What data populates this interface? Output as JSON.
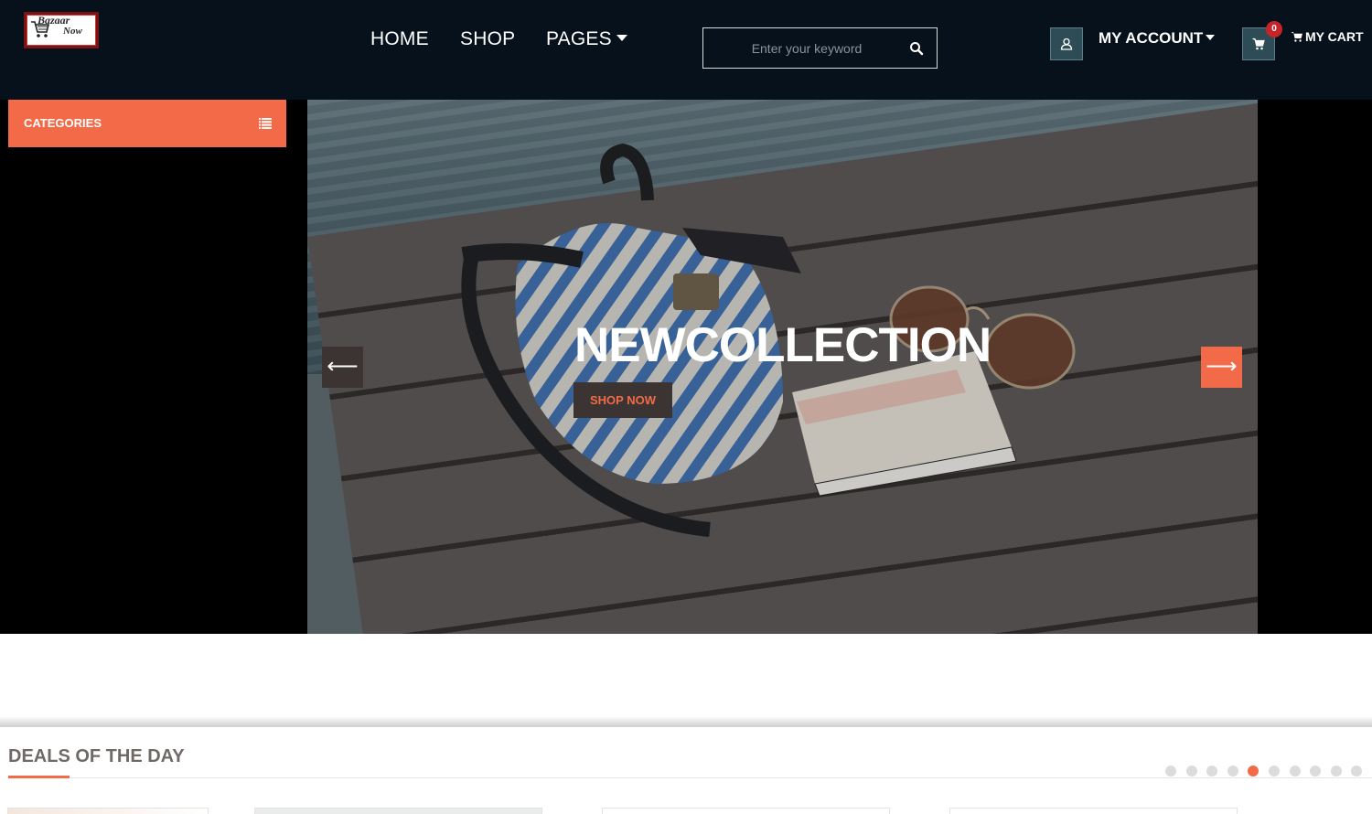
{
  "header": {
    "logo": {
      "line1": "Bazaar",
      "line2": "Now"
    },
    "nav": [
      {
        "label": "HOME"
      },
      {
        "label": "SHOP"
      },
      {
        "label": "PAGES"
      }
    ],
    "search": {
      "placeholder": "Enter your keyword",
      "value": ""
    },
    "account": {
      "label": "MY ACCOUNT"
    },
    "cart": {
      "count": "0",
      "label": "MY CART"
    }
  },
  "sidebar": {
    "categories_label": "CATEGORIES"
  },
  "slider": {
    "title": "NEWCOLLECTION",
    "button_label": "SHOP NOW",
    "prev_arrow": "⟵",
    "next_arrow": "⟶",
    "total_dots": 10,
    "active_dot": 5
  },
  "deals": {
    "title": "DEALS OF THE DAY"
  },
  "colors": {
    "accent": "#f26a48",
    "header_bg": "#06111c",
    "icon_box": "#2d4c56",
    "dark_button": "#3b3433"
  }
}
